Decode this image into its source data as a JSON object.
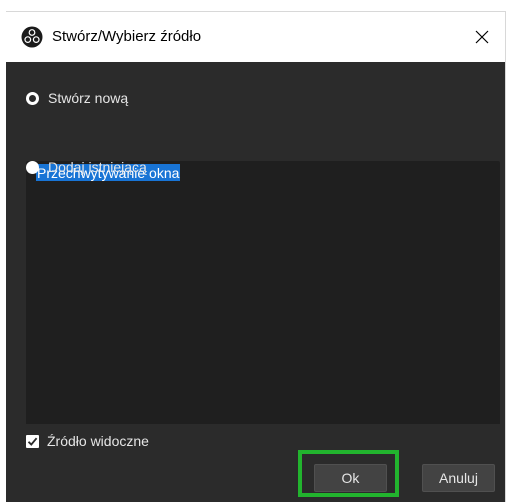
{
  "dialog": {
    "title": "Stwórz/Wybierz źródło",
    "app_icon": "obs-logo-icon",
    "close_icon": "close-icon"
  },
  "create_new": {
    "label": "Stwórz nową",
    "selected": true,
    "name_value": "Przechwytywanie okna"
  },
  "add_existing": {
    "label": "Dodaj istniejącą",
    "selected": false,
    "items": []
  },
  "visible_source": {
    "label": "Źródło widoczne",
    "checked": true
  },
  "buttons": {
    "ok_label": "Ok",
    "cancel_label": "Anuluj"
  },
  "colors": {
    "dialog_bg": "#2b2b2b",
    "field_bg": "#1f1f1f",
    "selection": "#1874d5",
    "highlight": "#22b42e",
    "button_bg": "#434343"
  }
}
